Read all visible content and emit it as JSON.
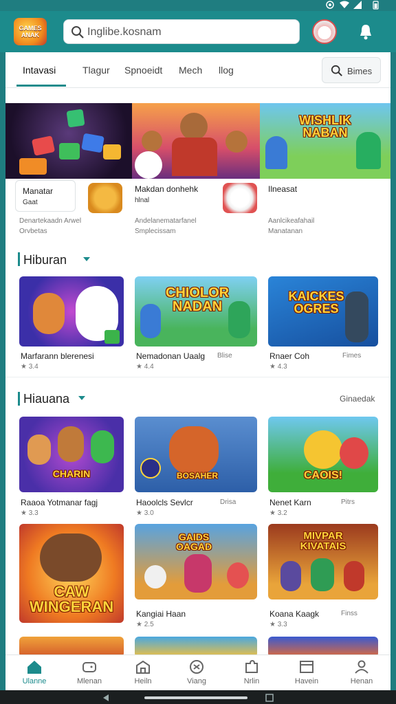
{
  "search": {
    "value": "Inglibe.kosnam"
  },
  "tabs": [
    "Intavasi",
    "Tlagur",
    "Spnoeidt",
    "Mech",
    "llog"
  ],
  "tab_button": "Bimes",
  "featured": [
    {
      "title": "Manatar",
      "badge": "Gaat",
      "desc1": "Denartekaadn Arwel",
      "desc2": "Orvbetas"
    },
    {
      "title": "Makdan donhehk",
      "badge": "hlnal",
      "desc1": "Andelanematarfanel",
      "desc2": "Smplecissam"
    },
    {
      "title": "Ilneasat",
      "badge": "",
      "desc1": "Aanlcikeafahail",
      "desc2": "Manatanan"
    }
  ],
  "section1": {
    "title": "Hiburan",
    "games": [
      {
        "title": "Marfarann blerenesi",
        "meta": "★ 3.4",
        "tag": "",
        "art": ""
      },
      {
        "title": "Nemadonan Uaalg",
        "meta": "★ 4.4",
        "tag": "Blise",
        "art": "CHIOLOR NADAN"
      },
      {
        "title": "Rnaer Coh",
        "meta": "★ 4.3",
        "tag": "Fimes",
        "art": "KAICKES OGRES"
      }
    ]
  },
  "section2": {
    "title": "Hiauana",
    "more": "Ginaedak",
    "games": [
      {
        "title": "Raaoa Yotmanar fagj",
        "meta": "★ 3.3",
        "tag": "",
        "art": "CHARIN"
      },
      {
        "title": "Haoolcls Sevlcr",
        "meta": "★ 3.0",
        "tag": "Drisa",
        "art": "BOSAHER"
      },
      {
        "title": "Nenet Karn",
        "meta": "★ 3.2",
        "tag": "Pitrs",
        "art": "CAOIS!"
      },
      {
        "title": "",
        "meta": "",
        "tag": "",
        "art": "CAW WINGERAN"
      },
      {
        "title": "Kangiai Haan",
        "meta": "★ 2.5",
        "tag": "",
        "art": "GAIDS OAGAD"
      },
      {
        "title": "Koana Kaagk",
        "meta": "★ 3.3",
        "tag": "Finss",
        "art": "MIVPAR KIVATAIS"
      }
    ]
  },
  "nav": [
    "Ulanne",
    "Mlenan",
    "Heiln",
    "Viang",
    "Nrlin",
    "Havein",
    "Henan"
  ],
  "colors": {
    "accent": "#1c8b8c",
    "frame": "#1f7d80"
  }
}
